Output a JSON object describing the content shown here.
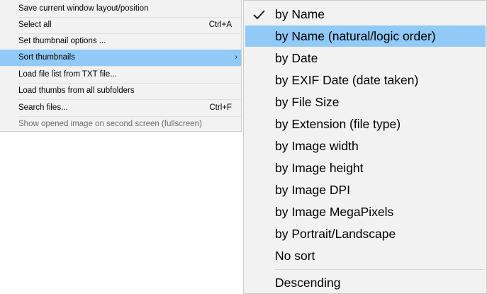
{
  "main_menu": {
    "items": [
      {
        "label": "Save current window layout/position",
        "shortcut": ""
      },
      {
        "label": "Select all",
        "shortcut": "Ctrl+A"
      },
      {
        "label": "Set thumbnail options ...",
        "shortcut": ""
      },
      {
        "label": "Sort thumbnails",
        "shortcut": "",
        "submenu_arrow": "›",
        "state": "highlighted"
      },
      {
        "label": "Load file list  from TXT file...",
        "shortcut": ""
      },
      {
        "label": "Load thumbs from all subfolders",
        "shortcut": ""
      },
      {
        "label": "Search files...",
        "shortcut": "Ctrl+F"
      },
      {
        "label": "Show opened image on second screen (fullscreen)",
        "shortcut": "",
        "state": "disabled"
      }
    ]
  },
  "sort_submenu": {
    "items": [
      {
        "label": "by Name",
        "checked": true,
        "icon": "checkmark-icon"
      },
      {
        "label": "by Name (natural/logic order)",
        "state": "highlighted"
      },
      {
        "label": "by Date"
      },
      {
        "label": "by EXIF Date (date taken)"
      },
      {
        "label": "by File Size"
      },
      {
        "label": "by Extension (file type)"
      },
      {
        "label": "by Image width"
      },
      {
        "label": "by Image height"
      },
      {
        "label": "by Image DPI"
      },
      {
        "label": "by Image MegaPixels"
      },
      {
        "label": "by Portrait/Landscape"
      },
      {
        "label": "No sort"
      },
      {
        "label": "Descending"
      }
    ]
  },
  "colors": {
    "menu_background": "#f2f2f2",
    "highlight": "#91c9f7",
    "disabled_text": "#6d6d6d"
  }
}
